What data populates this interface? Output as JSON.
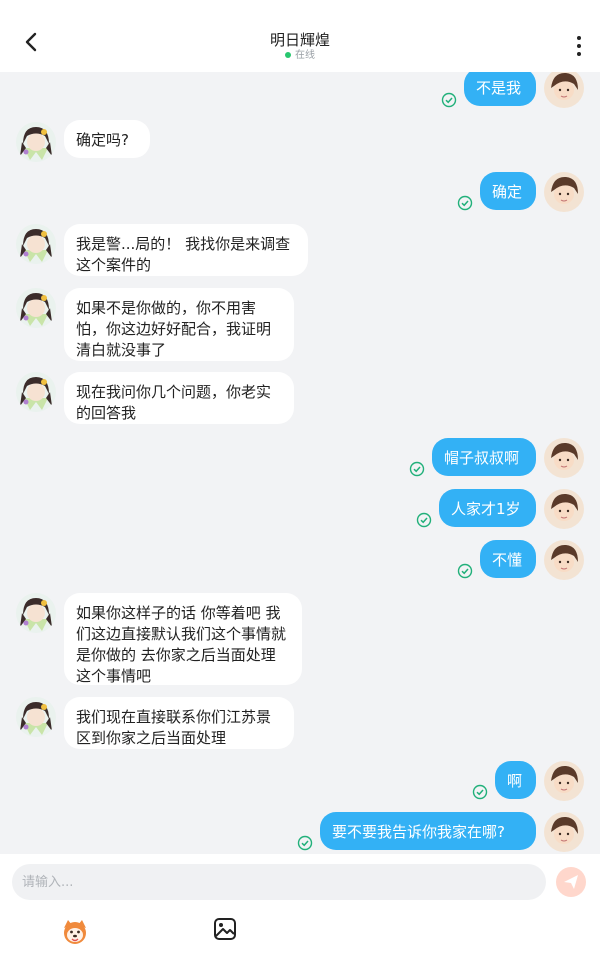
{
  "header": {
    "title": "明日輝煌",
    "status": "在线",
    "back_icon": "chevron-left-icon",
    "more_icon": "more-vertical-icon"
  },
  "messages": [
    {
      "from": "me",
      "text": "不是我",
      "read": true
    },
    {
      "from": "other",
      "text": "确定吗?"
    },
    {
      "from": "me",
      "text": "确定",
      "read": true
    },
    {
      "from": "other",
      "text": "我是警...局的！ 我找你是来调查这个案件的"
    },
    {
      "from": "other",
      "text": "如果不是你做的，你不用害怕，你这边好好配合，我证明清白就没事了"
    },
    {
      "from": "other",
      "text": "现在我问你几个问题，你老实的回答我"
    },
    {
      "from": "me",
      "text": "帽子叔叔啊",
      "read": true
    },
    {
      "from": "me",
      "text": "人家才1岁",
      "read": true
    },
    {
      "from": "me",
      "text": "不懂",
      "read": true
    },
    {
      "from": "other",
      "text": "如果你这样子的话 你等着吧 我们这边直接默认我们这个事情就是你做的 去你家之后当面处理这个事情吧"
    },
    {
      "from": "other",
      "text": "我们现在直接联系你们江苏景区到你家之后当面处理"
    },
    {
      "from": "me",
      "text": "啊",
      "read": true
    },
    {
      "from": "me",
      "text": "要不要我告诉你我家在哪?",
      "read": true
    }
  ],
  "input": {
    "placeholder": "请输入...",
    "send_icon": "send-icon",
    "emoji_icon": "emoji-face-icon",
    "image_icon": "image-icon"
  },
  "colors": {
    "my_bubble": "#33b1f5",
    "other_bubble": "#ffffff",
    "background": "#f2f3f5",
    "read_tick": "#21b07a",
    "online_dot": "#28c76f"
  }
}
